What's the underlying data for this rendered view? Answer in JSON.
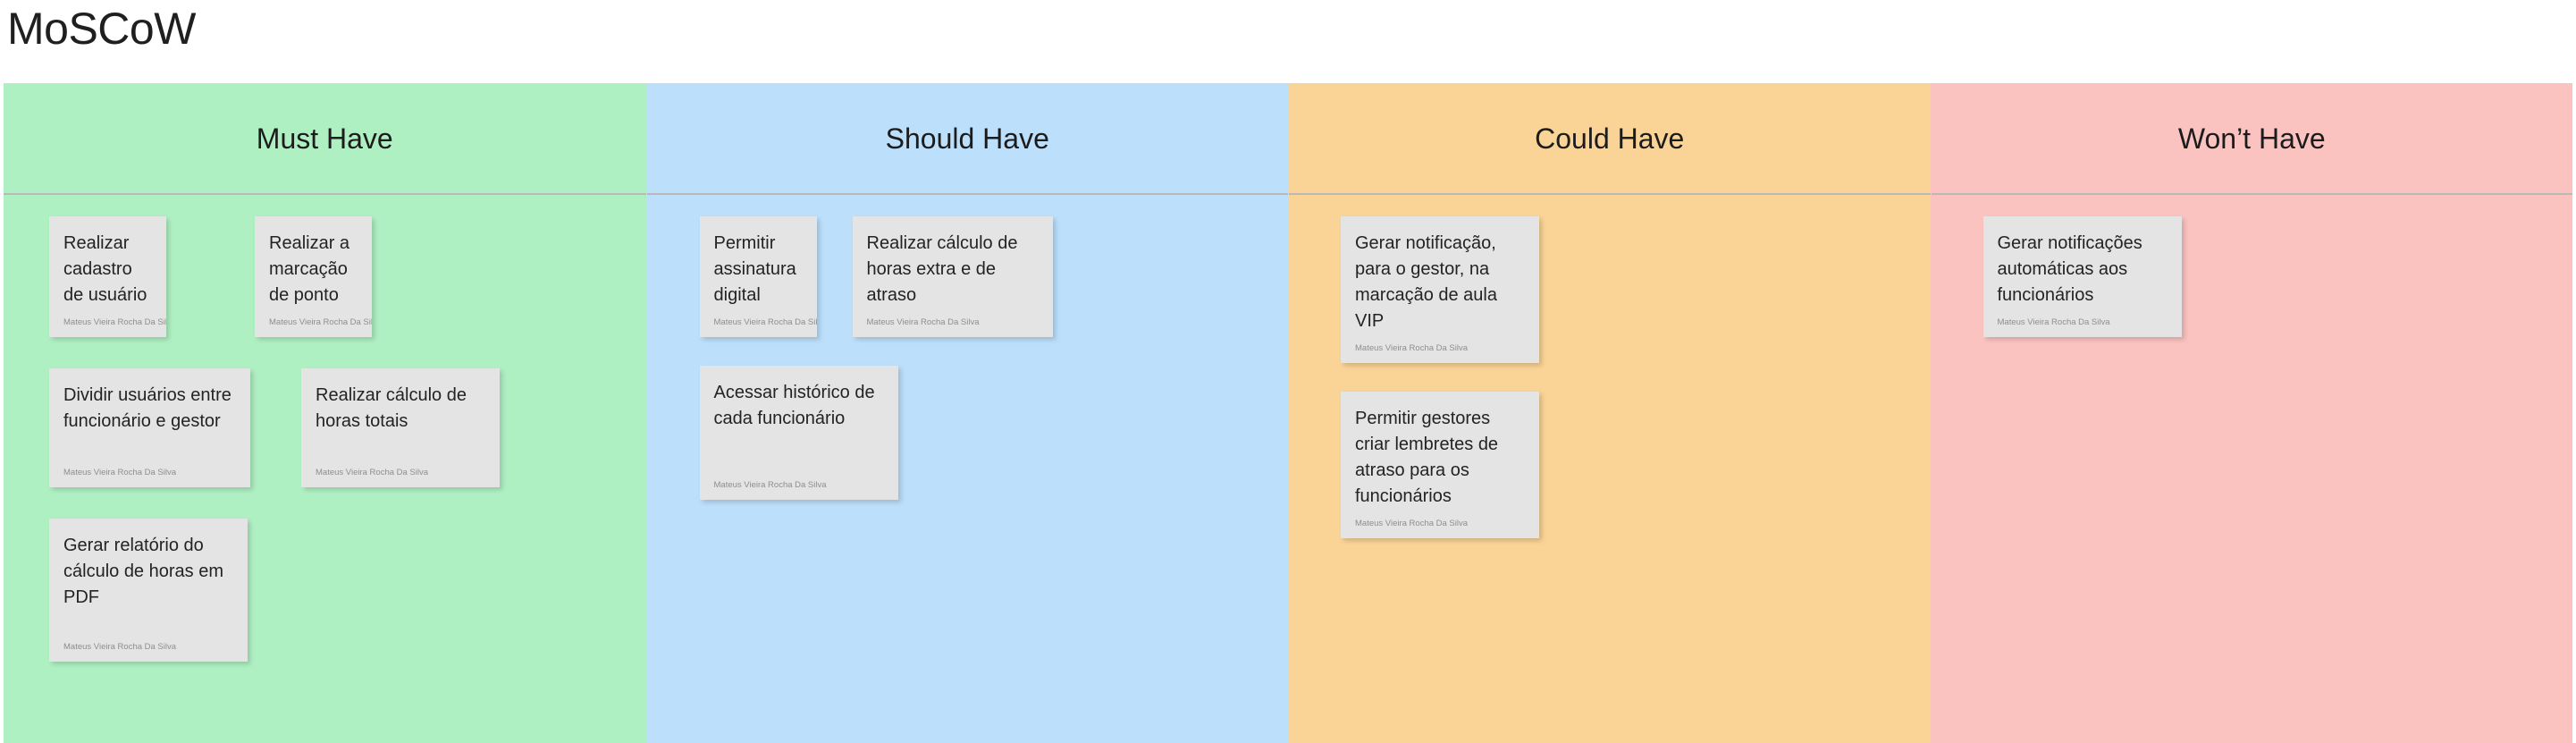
{
  "page": {
    "title": "MoSCoW"
  },
  "colors": {
    "must_have": "#aff0c3",
    "should_have": "#bcdffb",
    "could_have": "#fad396",
    "wont_have": "#fbc3c0",
    "card_bg": "#e4e4e4",
    "divider": "#b9b9b9",
    "text": "#232323",
    "author_text": "#8e8e8e"
  },
  "columns": [
    {
      "id": "must-have",
      "label": "Must Have",
      "bg": "#aff0c3",
      "rows": [
        {
          "cards": [
            {
              "text": "Realizar cadastro de usuário",
              "author": "Mateus Vieira Rocha Da Silva"
            },
            {
              "text": "Realizar a marcação de ponto",
              "author": "Mateus Vieira Rocha Da Silva"
            }
          ]
        },
        {
          "cards": [
            {
              "text": "Dividir usuários entre funcionário e gestor",
              "author": "Mateus Vieira Rocha Da Silva"
            },
            {
              "text": "Realizar cálculo de horas totais",
              "author": "Mateus Vieira Rocha Da Silva"
            }
          ]
        },
        {
          "cards": [
            {
              "text": "Gerar relatório do cálculo de horas em PDF",
              "author": "Mateus Vieira Rocha Da Silva"
            }
          ]
        }
      ]
    },
    {
      "id": "should-have",
      "label": "Should Have",
      "bg": "#bcdffb",
      "rows": [
        {
          "cards": [
            {
              "text": "Permitir assinatura digital",
              "author": "Mateus Vieira Rocha Da Silva"
            },
            {
              "text": "Realizar cálculo de horas extra e de atraso",
              "author": "Mateus Vieira Rocha Da Silva"
            }
          ]
        },
        {
          "cards": [
            {
              "text": "Acessar histórico de cada funcionário",
              "author": "Mateus Vieira Rocha Da Silva"
            }
          ]
        }
      ]
    },
    {
      "id": "could-have",
      "label": "Could Have",
      "bg": "#fad396",
      "rows": [
        {
          "cards": [
            {
              "text": "Gerar notificação, para o gestor, na marcação de aula VIP",
              "author": "Mateus Vieira Rocha Da Silva"
            }
          ]
        },
        {
          "cards": [
            {
              "text": "Permitir gestores criar lembretes de atraso para os funcionários",
              "author": "Mateus Vieira Rocha Da Silva"
            }
          ]
        }
      ]
    },
    {
      "id": "wont-have",
      "label": "Won’t Have",
      "bg": "#fbc3c0",
      "rows": [
        {
          "cards": [
            {
              "text": "Gerar notificações automáticas aos funcionários",
              "author": "Mateus Vieira Rocha Da Silva"
            }
          ]
        }
      ]
    }
  ]
}
